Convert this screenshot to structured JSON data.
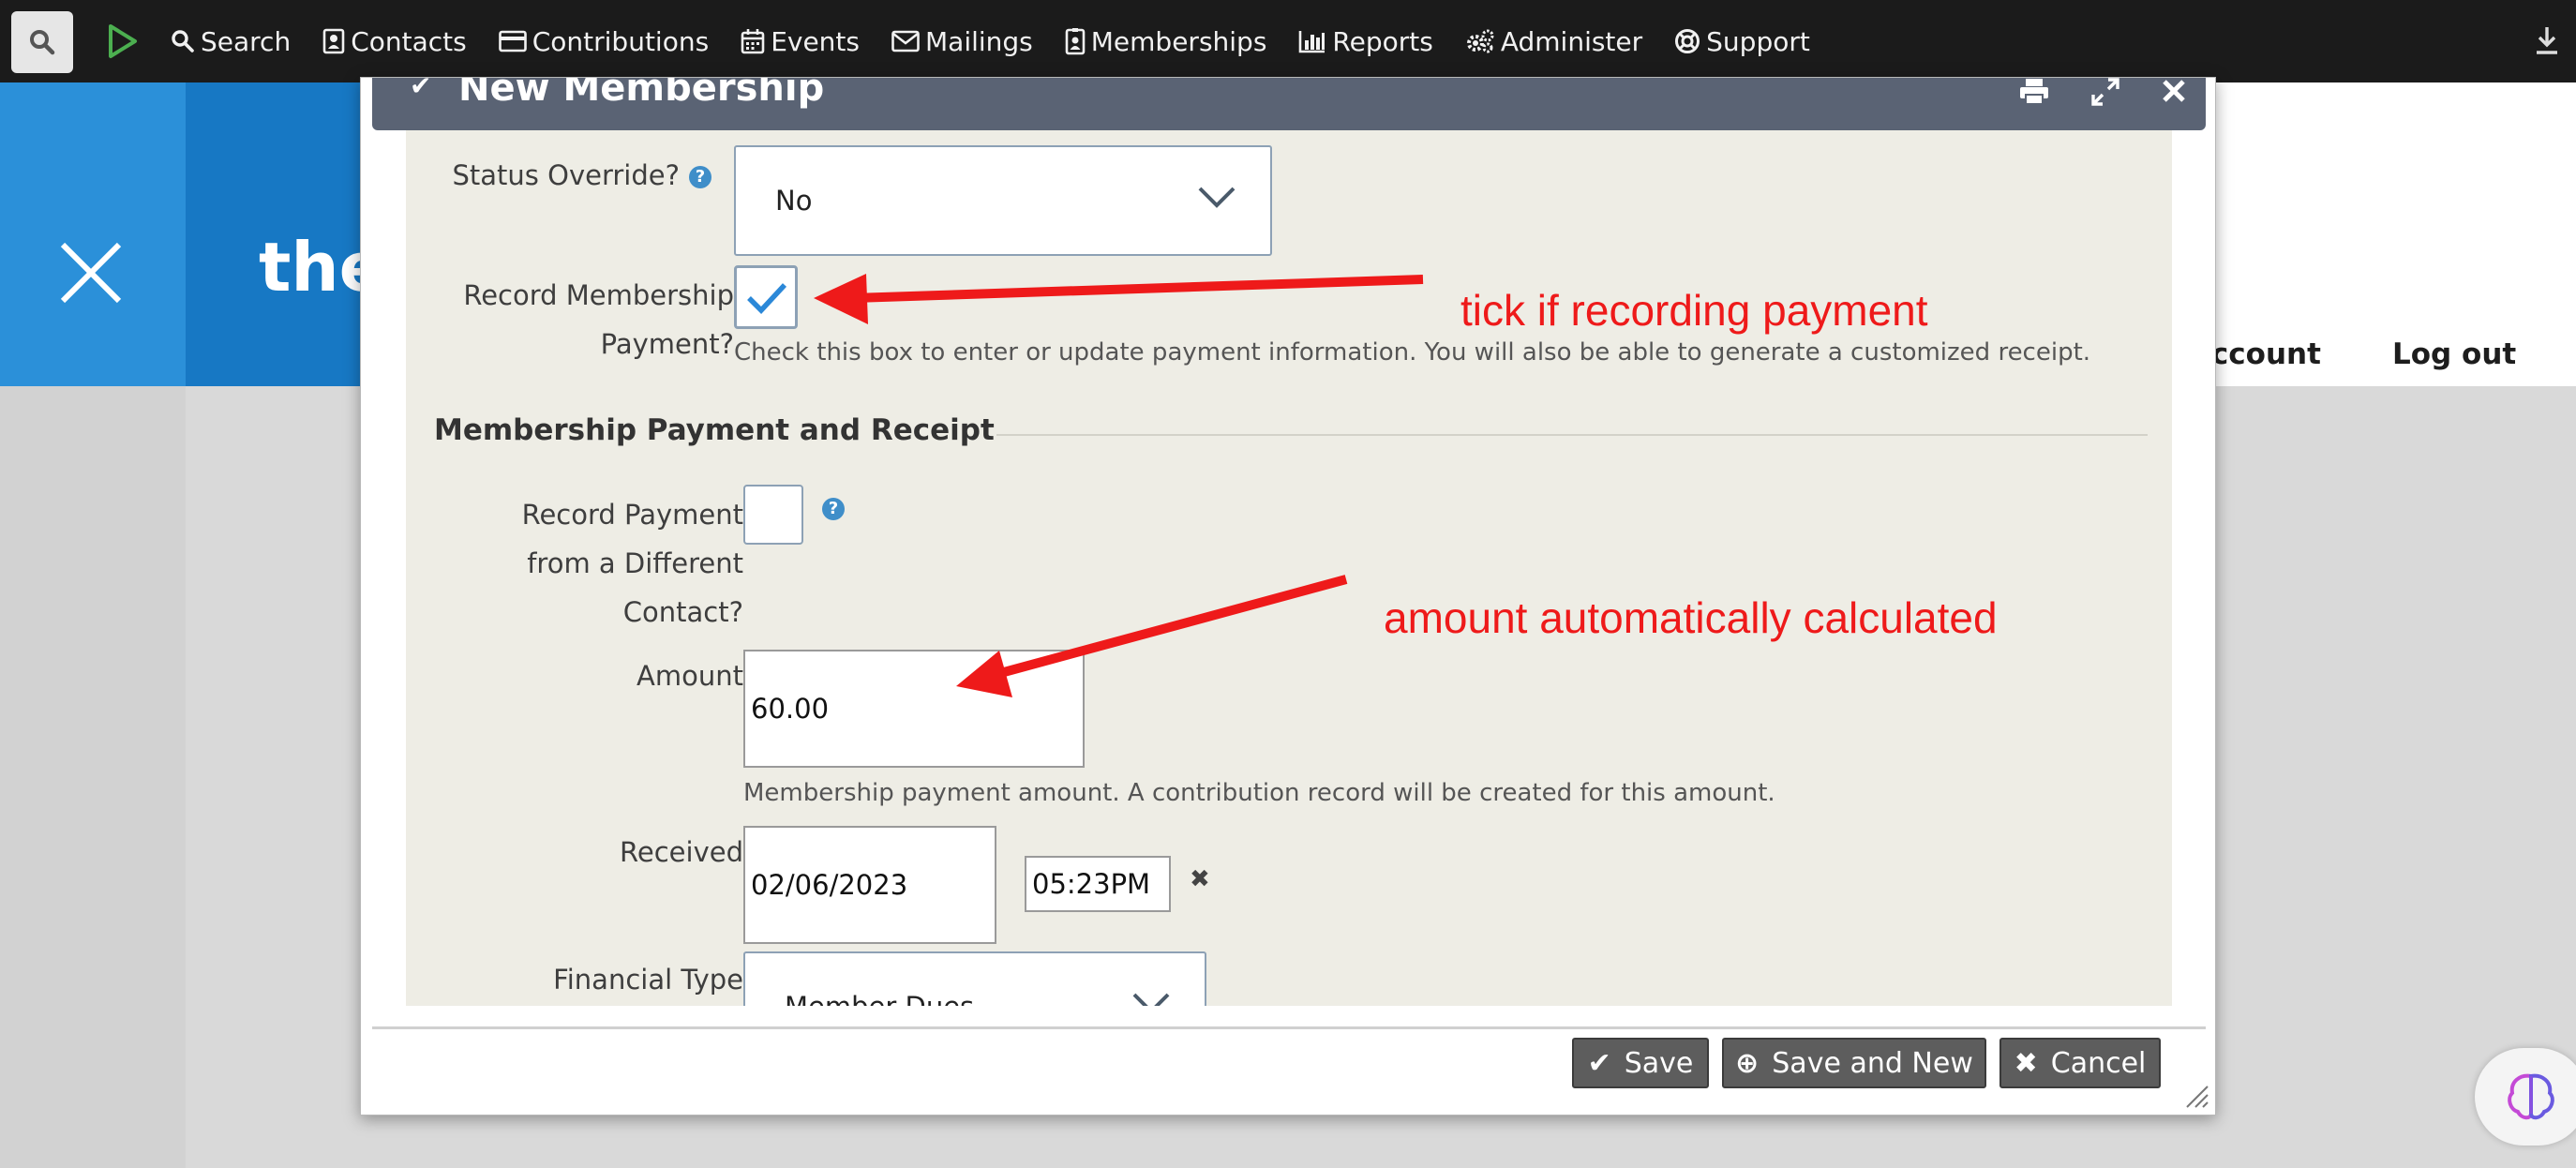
{
  "menubar": {
    "items": [
      {
        "label": "Search",
        "icon": "search-icon"
      },
      {
        "label": "Contacts",
        "icon": "contact-card-icon"
      },
      {
        "label": "Contributions",
        "icon": "credit-card-icon"
      },
      {
        "label": "Events",
        "icon": "calendar-icon"
      },
      {
        "label": "Mailings",
        "icon": "envelope-icon"
      },
      {
        "label": "Memberships",
        "icon": "id-badge-icon"
      },
      {
        "label": "Reports",
        "icon": "bar-chart-icon"
      },
      {
        "label": "Administer",
        "icon": "gears-icon"
      },
      {
        "label": "Support",
        "icon": "life-ring-icon"
      }
    ]
  },
  "site": {
    "name_fragment": "the",
    "account_link": "account",
    "logout_link": "Log out"
  },
  "dialog": {
    "title": "New Membership",
    "status_override": {
      "label": "Status Override?",
      "value": "No"
    },
    "record_payment": {
      "label_line1": "Record Membership",
      "label_line2": "Payment?",
      "checked": true,
      "description": "Check this box to enter or update payment information. You will also be able to generate a customized receipt."
    },
    "section_title": "Membership Payment and Receipt",
    "different_contact": {
      "label_line1": "Record Payment",
      "label_line2": "from a Different",
      "label_line3": "Contact?",
      "checked": false
    },
    "amount": {
      "label": "Amount",
      "value": "60.00",
      "description": "Membership payment amount. A contribution record will be created for this amount."
    },
    "received": {
      "label": "Received",
      "date": "02/06/2023",
      "time": "05:23PM"
    },
    "financial_type": {
      "label": "Financial Type",
      "value": "Member Dues"
    },
    "buttons": {
      "save": "Save",
      "save_and_new": "Save and New",
      "cancel": "Cancel"
    }
  },
  "annotations": {
    "note1": "tick if recording payment",
    "note2": "amount automatically calculated",
    "color": "#ee1a1a"
  }
}
